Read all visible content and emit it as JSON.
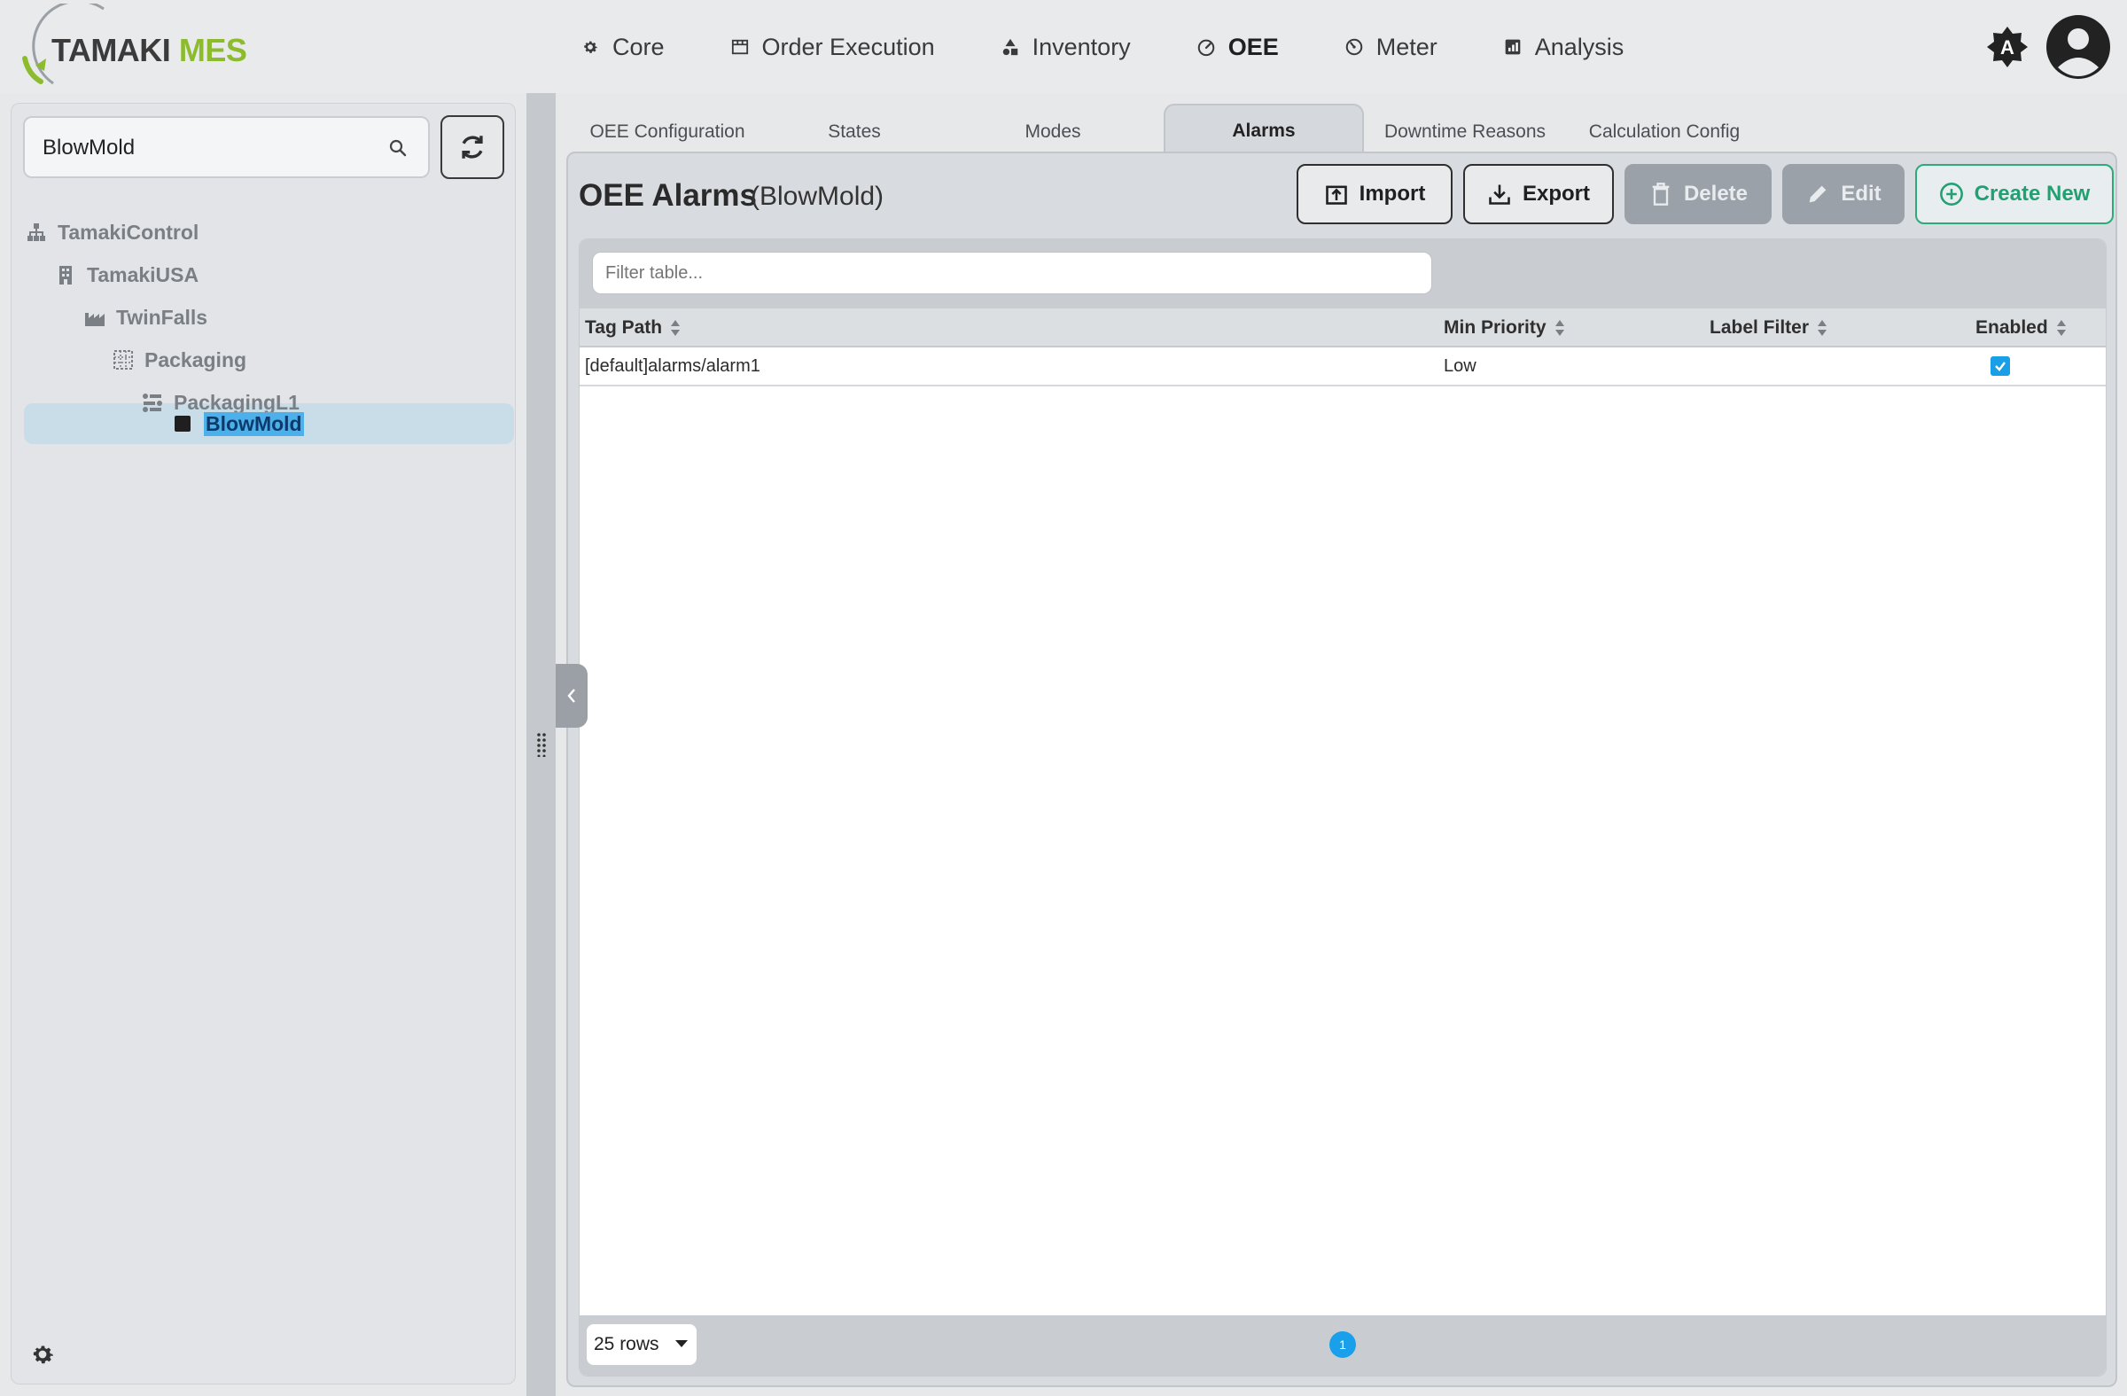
{
  "app": {
    "logo_word1": "TAMAKI",
    "logo_word2": "MES",
    "brand_green": "#8dbb2e",
    "accent_blue": "#1aa0ea",
    "create_green": "#22a072"
  },
  "nav": [
    {
      "label": "Core",
      "icon": "gear-icon"
    },
    {
      "label": "Order Execution",
      "icon": "store-icon"
    },
    {
      "label": "Inventory",
      "icon": "shapes-icon"
    },
    {
      "label": "OEE",
      "icon": "gauge-icon"
    },
    {
      "label": "Meter",
      "icon": "meter-icon"
    },
    {
      "label": "Analysis",
      "icon": "chart-icon"
    }
  ],
  "nav_active": "OEE",
  "header": {
    "theme_badge": "A"
  },
  "sidebar": {
    "search_value": "BlowMold",
    "tree": [
      {
        "label": "TamakiControl",
        "icon": "sitemap-icon"
      },
      {
        "label": "TamakiUSA",
        "icon": "building-icon"
      },
      {
        "label": "TwinFalls",
        "icon": "factory-icon"
      },
      {
        "label": "Packaging",
        "icon": "grid-icon"
      },
      {
        "label": "PackagingL1",
        "icon": "line-icon"
      },
      {
        "label": "BlowMold",
        "icon": "square-icon",
        "selected": true
      }
    ]
  },
  "tabs": [
    {
      "label": "OEE Configuration"
    },
    {
      "label": "States"
    },
    {
      "label": "Modes"
    },
    {
      "label": "Alarms",
      "active": true
    },
    {
      "label": "Downtime Reasons"
    },
    {
      "label": "Calculation Config"
    }
  ],
  "page": {
    "title": "OEE Alarms",
    "subtitle": "(BlowMold)"
  },
  "toolbar": {
    "import_label": "Import",
    "export_label": "Export",
    "delete_label": "Delete",
    "edit_label": "Edit",
    "create_label": "Create New"
  },
  "table": {
    "filter_placeholder": "Filter table...",
    "columns": [
      "Tag Path",
      "Min Priority",
      "Label Filter",
      "Enabled"
    ],
    "rows": [
      {
        "tag_path": "[default]alarms/alarm1",
        "min_priority": "Low",
        "label_filter": "",
        "enabled": true
      }
    ],
    "rows_per_page": "25 rows",
    "current_page": "1"
  }
}
